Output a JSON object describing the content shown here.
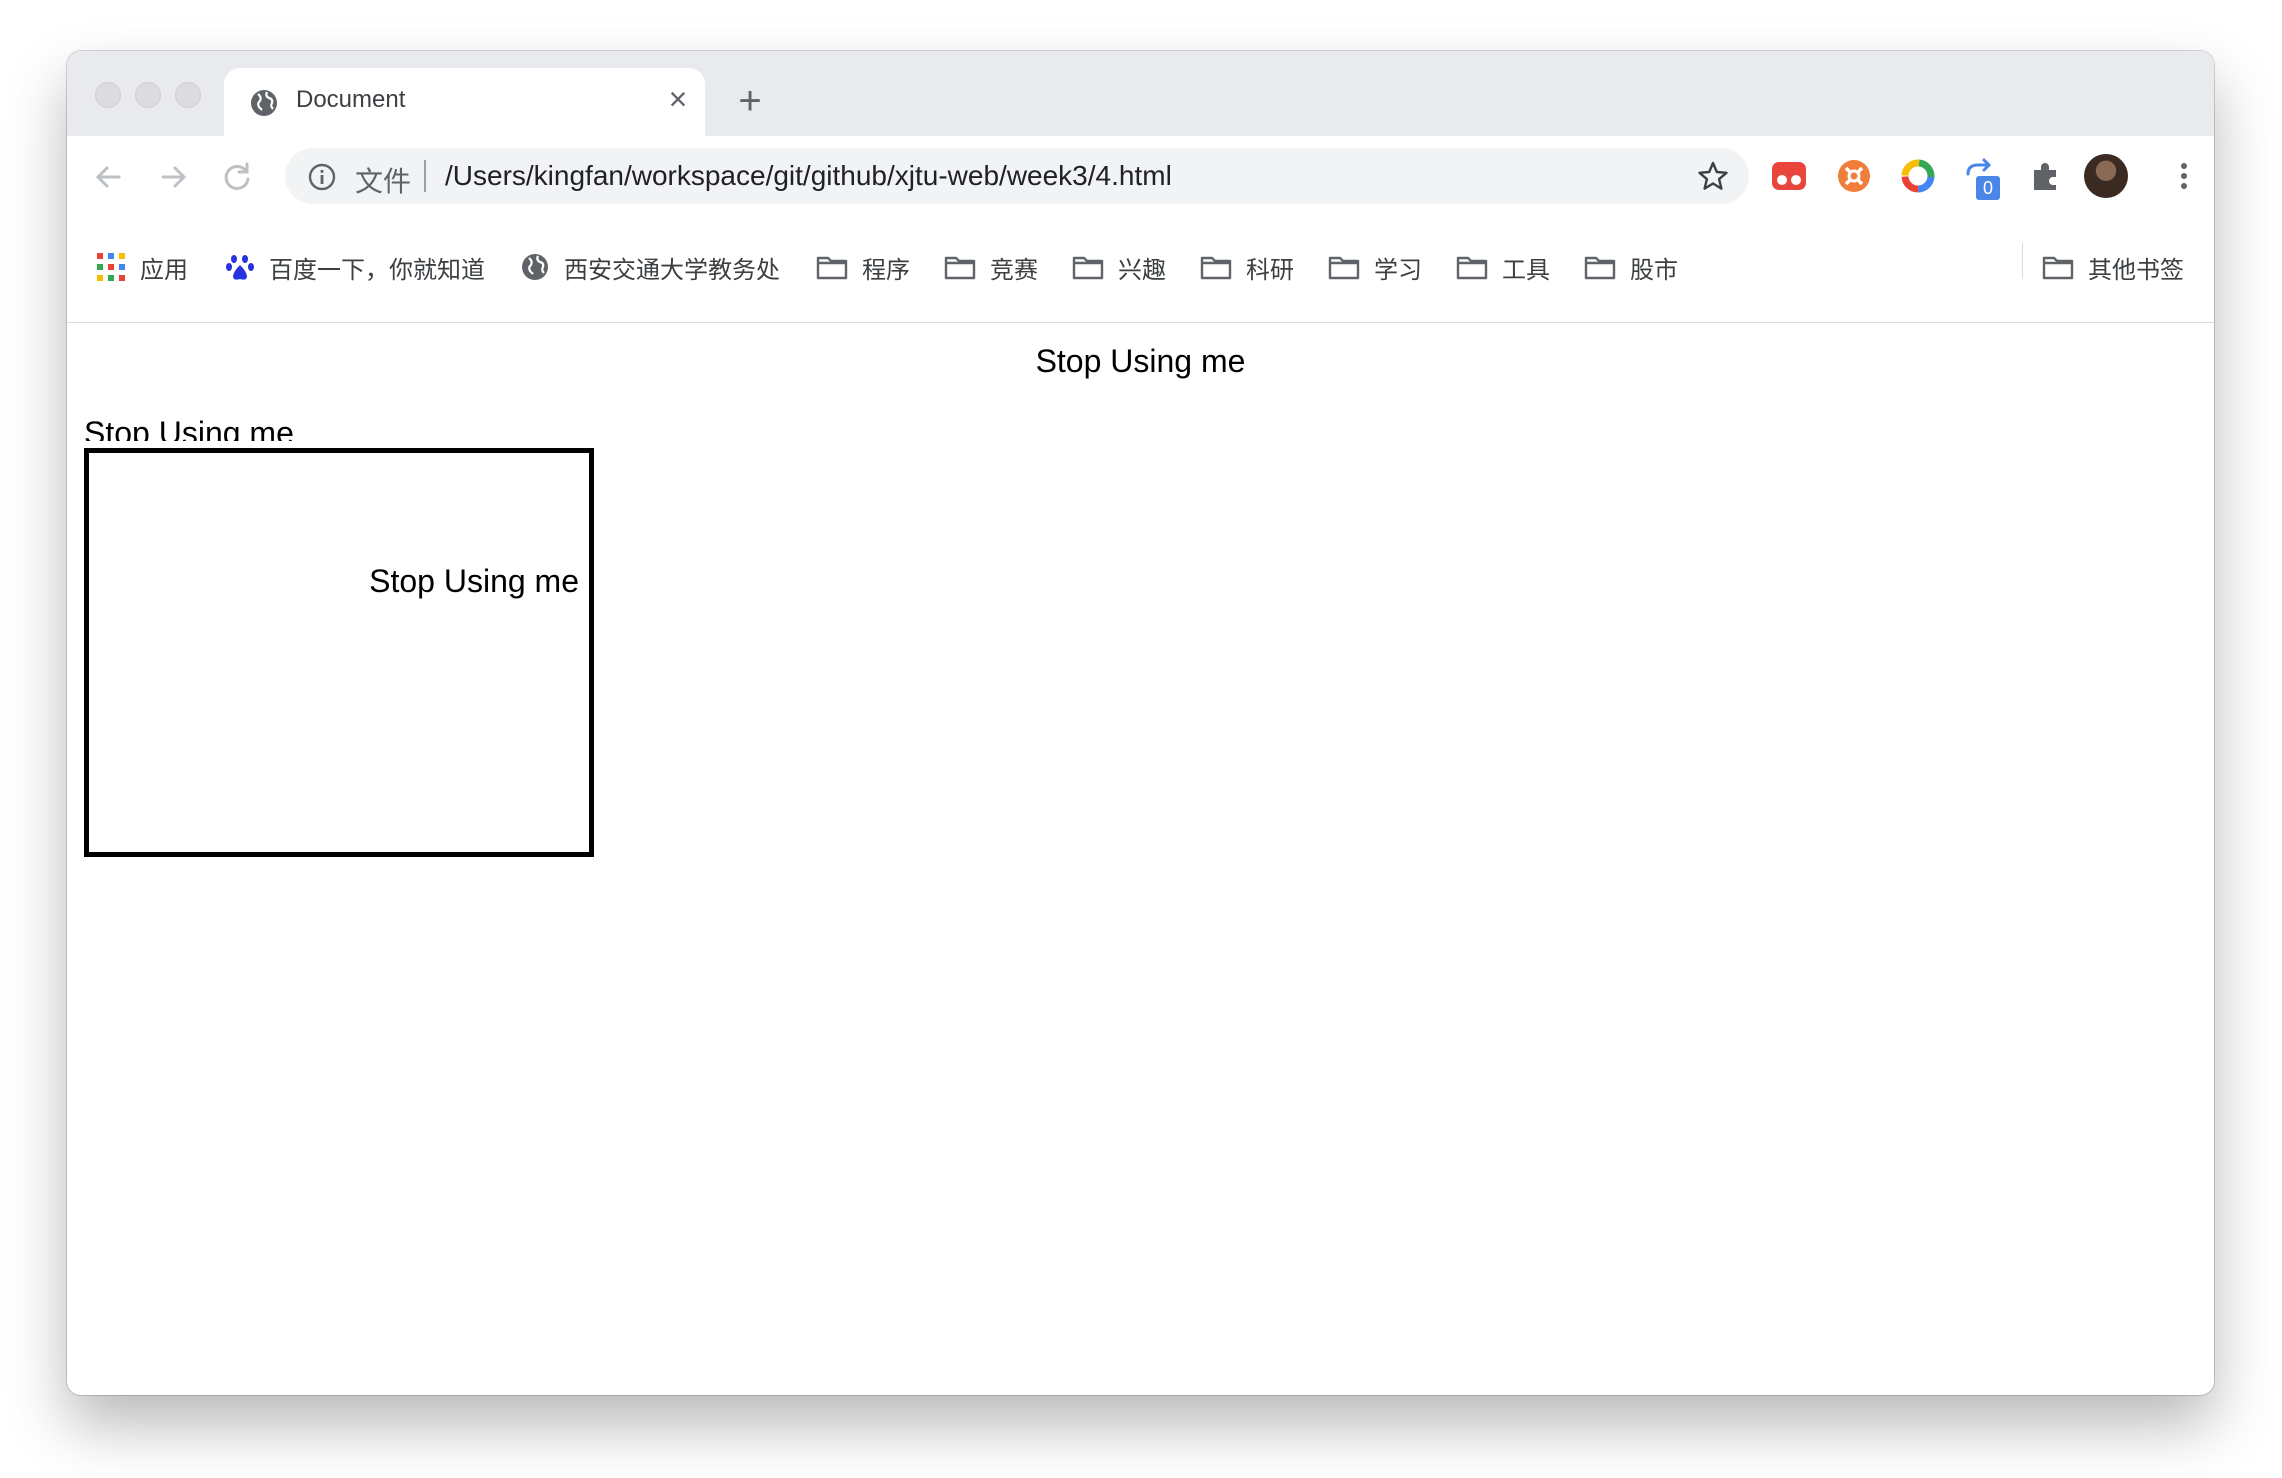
{
  "browser": {
    "tab": {
      "title": "Document",
      "close": "×"
    },
    "new_tab": "+",
    "address": {
      "scheme_label": "文件",
      "url": "/Users/kingfan/workspace/git/github/xjtu-web/week3/4.html"
    },
    "extensions": [
      {
        "name": "red-extension-icon",
        "color": "#e8453c"
      },
      {
        "name": "orange-extension-icon",
        "color": "#f07d3a"
      },
      {
        "name": "color-ring-extension-icon",
        "color": "#4285f4"
      },
      {
        "name": "sync-extension-icon",
        "badge": "0",
        "color": "#4a86e8"
      },
      {
        "name": "puzzle-extensions-icon",
        "color": "#5f6368"
      }
    ],
    "bookmarks": [
      {
        "label": "应用",
        "icon": "apps-grid-icon"
      },
      {
        "label": "百度一下，你就知道",
        "icon": "baidu-paw-icon"
      },
      {
        "label": "西安交通大学教务处",
        "icon": "globe-icon"
      },
      {
        "label": "程序",
        "icon": "folder-icon"
      },
      {
        "label": "竞赛",
        "icon": "folder-icon"
      },
      {
        "label": "兴趣",
        "icon": "folder-icon"
      },
      {
        "label": "科研",
        "icon": "folder-icon"
      },
      {
        "label": "学习",
        "icon": "folder-icon"
      },
      {
        "label": "工具",
        "icon": "folder-icon"
      },
      {
        "label": "股市",
        "icon": "folder-icon"
      }
    ],
    "other_bookmarks": "其他书签"
  },
  "page": {
    "centered_text": "Stop Using me",
    "clipped_text": "Stop Using me",
    "box_text": "Stop Using me"
  }
}
